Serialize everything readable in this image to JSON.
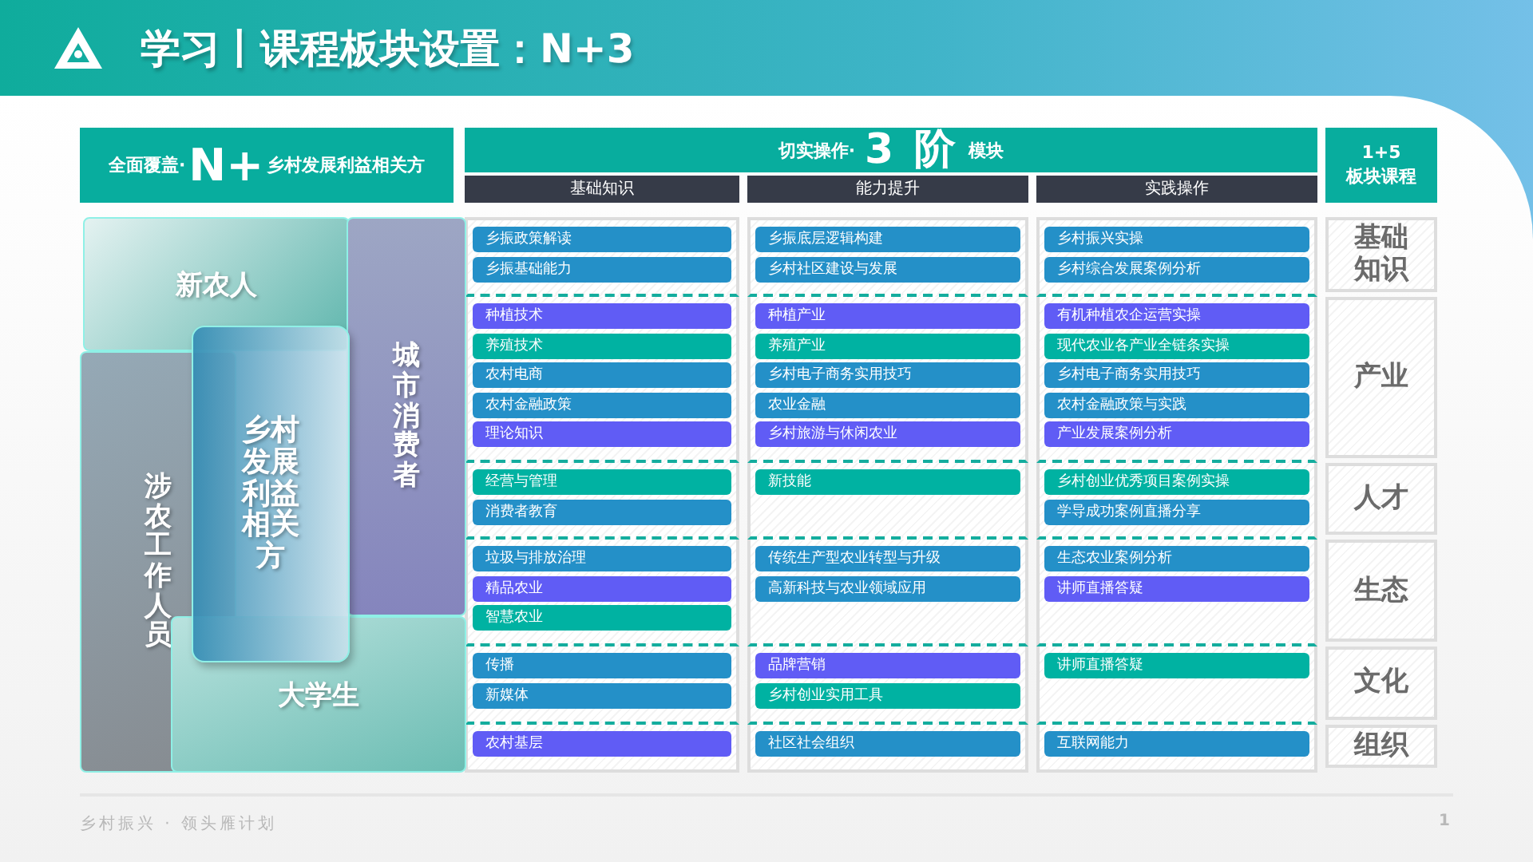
{
  "header": {
    "title": "学习丨课程板块设置：N+3"
  },
  "banner": {
    "left": {
      "prefix": "全面覆盖·",
      "highlight": "N+",
      "suffix": "乡村发展利益相关方"
    },
    "middle": {
      "prefix": "切实操作·",
      "highlight": "3 阶",
      "suffix": "模块"
    },
    "right": [
      "1+5",
      "板块课程"
    ],
    "columns": [
      "基础知识",
      "能力提升",
      "实践操作"
    ]
  },
  "diagram": [
    {
      "label": "新农人",
      "kind": "farmer"
    },
    {
      "label": "城市消费者",
      "kind": "consumer"
    },
    {
      "label": "涉农工作人员",
      "kind": "worker"
    },
    {
      "label": "大学生",
      "kind": "student"
    },
    {
      "label": "乡村发展利益相关方",
      "kind": "center"
    }
  ],
  "rows": [
    {
      "category": "基础知识",
      "cells": [
        [
          {
            "label": "乡振政策解读",
            "color": "#2490c8"
          },
          {
            "label": "乡振基础能力",
            "color": "#2490c8"
          }
        ],
        [
          {
            "label": "乡振底层逻辑构建",
            "color": "#2490c8"
          },
          {
            "label": "乡村社区建设与发展",
            "color": "#2490c8"
          }
        ],
        [
          {
            "label": "乡村振兴实操",
            "color": "#2490c8"
          },
          {
            "label": "乡村综合发展案例分析",
            "color": "#2490c8"
          }
        ]
      ]
    },
    {
      "category": "产业",
      "cells": [
        [
          {
            "label": "种植技术",
            "color": "#605cf5"
          },
          {
            "label": "养殖技术",
            "color": "#00b2a2"
          },
          {
            "label": "农村电商",
            "color": "#2490c8"
          },
          {
            "label": "农村金融政策",
            "color": "#2490c8"
          },
          {
            "label": "理论知识",
            "color": "#605cf5"
          }
        ],
        [
          {
            "label": "种植产业",
            "color": "#605cf5"
          },
          {
            "label": "养殖产业",
            "color": "#00b2a2"
          },
          {
            "label": "乡村电子商务实用技巧",
            "color": "#2490c8"
          },
          {
            "label": "农业金融",
            "color": "#2490c8"
          },
          {
            "label": "乡村旅游与休闲农业",
            "color": "#605cf5"
          }
        ],
        [
          {
            "label": "有机种植农企运营实操",
            "color": "#605cf5"
          },
          {
            "label": "现代农业各产业全链条实操",
            "color": "#00b2a2"
          },
          {
            "label": "乡村电子商务实用技巧",
            "color": "#2490c8"
          },
          {
            "label": "农村金融政策与实践",
            "color": "#2490c8"
          },
          {
            "label": "产业发展案例分析",
            "color": "#605cf5"
          }
        ]
      ]
    },
    {
      "category": "人才",
      "cells": [
        [
          {
            "label": "经营与管理",
            "color": "#00b2a2"
          },
          {
            "label": "消费者教育",
            "color": "#2490c8"
          }
        ],
        [
          {
            "label": "新技能",
            "color": "#00b2a2"
          }
        ],
        [
          {
            "label": "乡村创业优秀项目案例实操",
            "color": "#00b2a2"
          },
          {
            "label": "学导成功案例直播分享",
            "color": "#2490c8"
          }
        ]
      ]
    },
    {
      "category": "生态",
      "cells": [
        [
          {
            "label": "垃圾与排放治理",
            "color": "#2490c8"
          },
          {
            "label": "精品农业",
            "color": "#605cf5"
          },
          {
            "label": "智慧农业",
            "color": "#00b2a2"
          }
        ],
        [
          {
            "label": "传统生产型农业转型与升级",
            "color": "#2490c8"
          },
          {
            "label": "高新科技与农业领域应用",
            "color": "#2490c8"
          }
        ],
        [
          {
            "label": "生态农业案例分析",
            "color": "#2490c8"
          },
          {
            "label": "讲师直播答疑",
            "color": "#605cf5"
          }
        ]
      ]
    },
    {
      "category": "文化",
      "cells": [
        [
          {
            "label": "传播",
            "color": "#2490c8"
          },
          {
            "label": "新媒体",
            "color": "#2490c8"
          }
        ],
        [
          {
            "label": "品牌营销",
            "color": "#605cf5"
          },
          {
            "label": "乡村创业实用工具",
            "color": "#00b2a2"
          }
        ],
        [
          {
            "label": "讲师直播答疑",
            "color": "#00b2a2"
          }
        ]
      ]
    },
    {
      "category": "组织",
      "cells": [
        [
          {
            "label": "农村基层",
            "color": "#605cf5"
          }
        ],
        [
          {
            "label": "社区社会组织",
            "color": "#2490c8"
          }
        ],
        [
          {
            "label": "互联网能力",
            "color": "#2490c8"
          }
        ]
      ]
    }
  ],
  "footer": {
    "text": "乡村振兴 · 领头雁计划",
    "page": "1"
  }
}
